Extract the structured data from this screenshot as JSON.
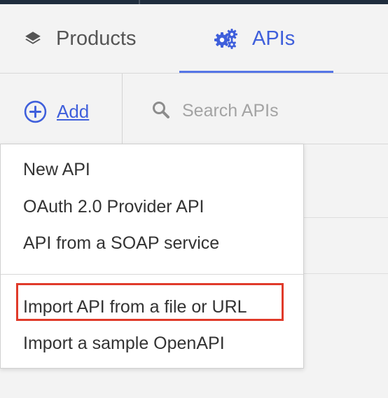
{
  "tabs": [
    {
      "label": "Products",
      "icon": "layers-icon",
      "active": false
    },
    {
      "label": "APIs",
      "icon": "gears-icon",
      "active": true
    }
  ],
  "toolbar": {
    "add_label": "Add",
    "add_icon": "plus-circle-icon",
    "search_icon": "search-icon",
    "search_placeholder": "Search APIs",
    "search_value": ""
  },
  "add_menu": {
    "items": [
      {
        "label": "New API"
      },
      {
        "label": "OAuth 2.0 Provider API"
      },
      {
        "label": "API from a SOAP service"
      },
      {
        "label": "Import API from a file or URL",
        "highlighted": true
      },
      {
        "label": "Import a sample OpenAPI"
      }
    ]
  },
  "colors": {
    "accent": "#3f5fdb",
    "tab_underline": "#5575e6",
    "highlight_border": "#e03a2a",
    "background": "#f3f3f3",
    "topbar": "#1f2d3d"
  }
}
